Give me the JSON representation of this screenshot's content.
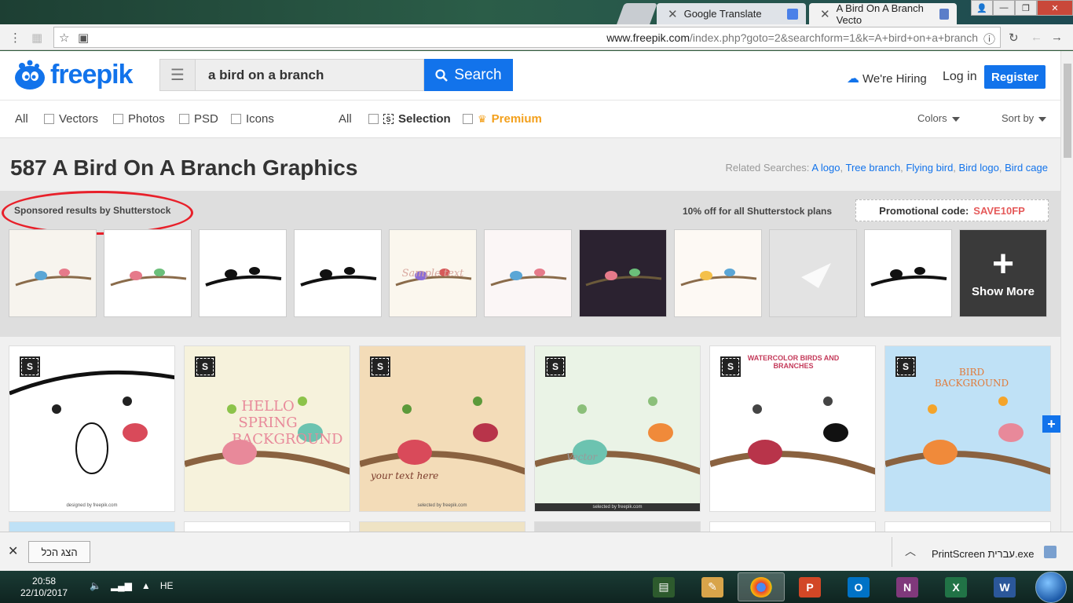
{
  "browser": {
    "tabs": [
      {
        "title": "",
        "active": false
      },
      {
        "title": "Google Translate",
        "active": false
      },
      {
        "title": "A Bird On A Branch Vecto",
        "active": true
      }
    ],
    "url_domain": "www.freepik.com",
    "url_path": "/index.php?goto=2&searchform=1&k=A+bird+on+a+branch"
  },
  "header": {
    "logo_text": "freepik",
    "search_value": "a bird on a branch",
    "search_button": "Search",
    "hiring": "We're Hiring",
    "login": "Log in",
    "register": "Register"
  },
  "filters": {
    "all_types": "All",
    "types": [
      "Vectors",
      "Photos",
      "PSD",
      "Icons"
    ],
    "all_source": "All",
    "selection": "Selection",
    "premium": "Premium",
    "colors": "Colors",
    "sort_by": "Sort by"
  },
  "results": {
    "title": "587 A Bird On A Branch Graphics",
    "related_label": "Related Searches:",
    "related": [
      "A logo",
      "Tree branch",
      "Flying bird",
      "Bird logo",
      "Bird cage"
    ]
  },
  "sponsored": {
    "label": "Sponsored results by Shutterstock",
    "offer": "10% off for all Shutterstock plans",
    "promo_label": "Promotional code:",
    "promo_code": "SAVE10FP",
    "show_more": "Show More",
    "thumbs": [
      {
        "bg": "#f7f4ee",
        "caption": ""
      },
      {
        "bg": "#ffffff",
        "caption": ""
      },
      {
        "bg": "#ffffff",
        "caption": ""
      },
      {
        "bg": "#ffffff",
        "caption": ""
      },
      {
        "bg": "#fbf7ee",
        "caption": "Sample text"
      },
      {
        "bg": "#fbf6f6",
        "caption": ""
      },
      {
        "bg": "#2b2230",
        "caption": ""
      },
      {
        "bg": "#fdf9f4",
        "caption": ""
      },
      {
        "bg": "#e6e6e6",
        "caption": ""
      },
      {
        "bg": "#ffffff",
        "caption": ""
      }
    ]
  },
  "grid": [
    {
      "bg": "#ffffff",
      "text": "",
      "footer": "designed by freepik.com"
    },
    {
      "bg": "#f6f2dc",
      "text": "HELLO SPRING BACKGROUND",
      "footer": ""
    },
    {
      "bg": "#f3dcb8",
      "text": "your text here",
      "footer": "selected by freepik.com"
    },
    {
      "bg": "#eaf3e6",
      "text": "Vector",
      "footer": "selected by freepik.com"
    },
    {
      "bg": "#ffffff",
      "text": "WATERCOLOR BIRDS AND BRANCHES",
      "footer": ""
    },
    {
      "bg": "#bfe1f6",
      "text": "BIRD BACKGROUND",
      "footer": ""
    }
  ],
  "downloads": {
    "show_all": "הצג הכל",
    "file": "PrintScreen עברית.exe"
  },
  "taskbar": {
    "time": "20:58",
    "date": "22/10/2017",
    "lang": "HE",
    "apps": [
      "terminal",
      "paint",
      "chrome",
      "powerpoint",
      "outlook",
      "onenote",
      "excel",
      "word"
    ]
  },
  "colors": {
    "brand": "#1273eb",
    "premium": "#f3a01c",
    "promo_code": "#e55a5a",
    "annotation": "#e8202a"
  }
}
